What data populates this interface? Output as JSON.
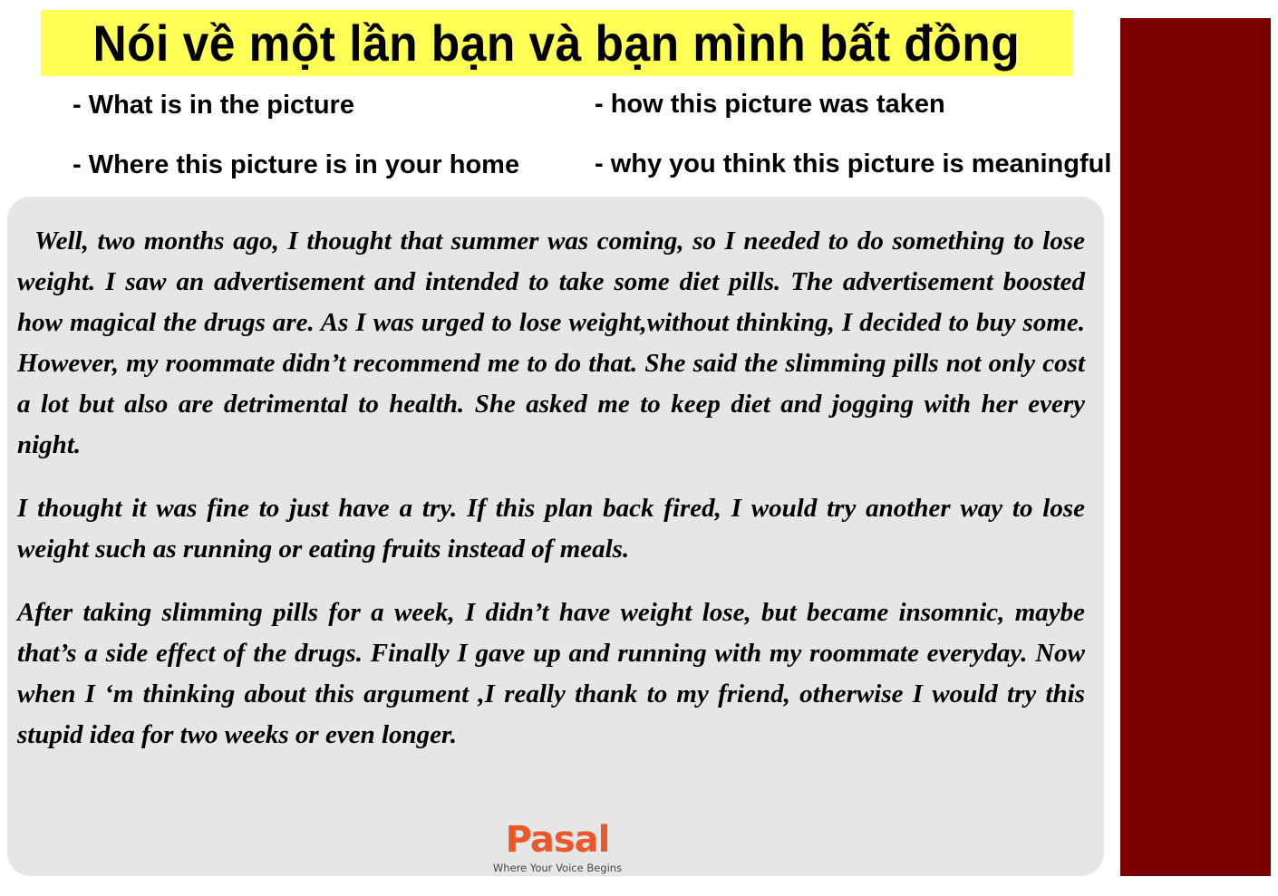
{
  "title": "Nói về một lần bạn và bạn mình bất đồng",
  "prompts": [
    "- What is in the picture",
    "- how this picture was taken",
    "- Where this picture is in your home",
    "- why you think this picture is meaningful"
  ],
  "paragraphs": [
    "Well, two months ago, I thought that summer was coming, so I needed to do something to lose weight. I saw an advertisement and intended to take some diet pills. The advertisement boosted how magical the drugs are. As I was urged to lose weight,without thinking, I decided to buy some. However, my roommate didn’t recommend me to do that. She said the slimming pills not only cost a lot but also are detrimental to health. She asked me to keep diet and jogging with her every night.",
    "I thought it was fine to just have a try. If this plan back fired, I would try another way to lose weight such as running or eating fruits instead of meals.",
    "After taking slimming pills for a week, I didn’t have weight lose, but became insomnic, maybe that’s a side effect of the drugs. Finally I gave up and running with my roommate everyday. Now when I ‘m thinking about this argument ,I really thank to my friend, otherwise I would try this stupid idea for two weeks or even longer."
  ],
  "logo": {
    "name": "Pasal",
    "tagline": "Where Your Voice Begins"
  },
  "colors": {
    "title_background": "#ffff55",
    "side_panel": "#7a0000",
    "content_background": "#e6e6e6",
    "logo_accent": "#e8582b"
  }
}
